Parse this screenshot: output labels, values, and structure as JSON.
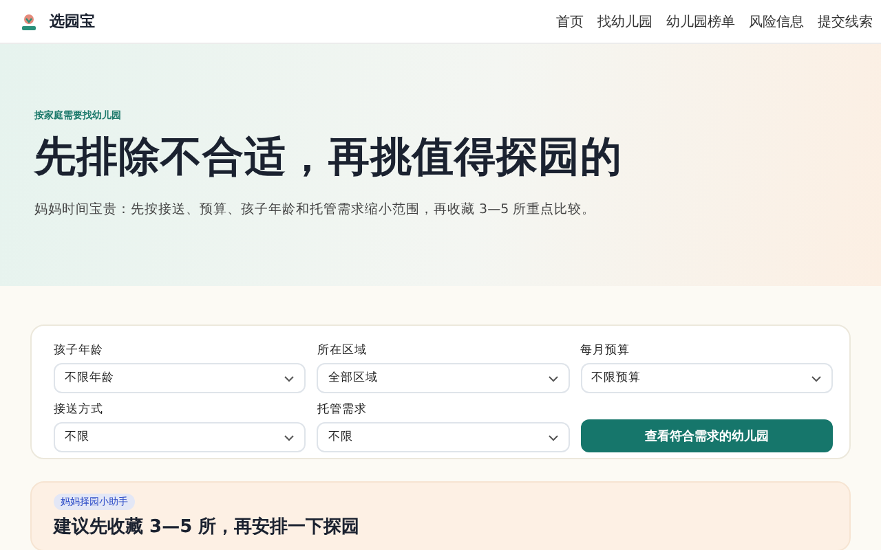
{
  "header": {
    "brand": "选园宝",
    "nav": [
      {
        "label": "首页"
      },
      {
        "label": "找幼儿园"
      },
      {
        "label": "幼儿园榜单"
      },
      {
        "label": "风险信息"
      },
      {
        "label": "提交线索"
      }
    ]
  },
  "hero": {
    "eyebrow": "按家庭需要找幼儿园",
    "title": "先排除不合适，再挑值得探园的",
    "subtitle": "妈妈时间宝贵：先按接送、预算、孩子年龄和托管需求缩小范围，再收藏 3—5 所重点比较。"
  },
  "filters": {
    "fields": [
      {
        "label": "孩子年龄",
        "value": "不限年龄"
      },
      {
        "label": "所在区域",
        "value": "全部区域"
      },
      {
        "label": "每月预算",
        "value": "不限预算"
      },
      {
        "label": "接送方式",
        "value": "不限"
      },
      {
        "label": "托管需求",
        "value": "不限"
      }
    ],
    "submit": "查看符合需求的幼儿园"
  },
  "helper": {
    "badge": "妈妈择园小助手",
    "title": "建议先收藏 3—5 所，再安排一下探园"
  }
}
